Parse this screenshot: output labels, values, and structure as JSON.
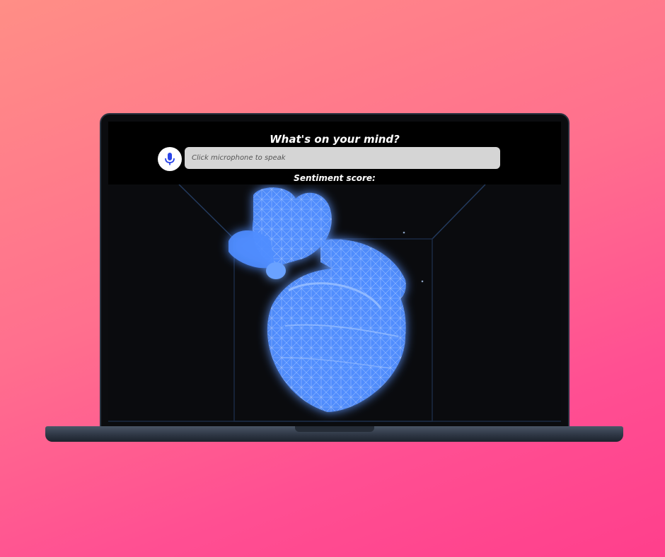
{
  "app": {
    "prompt_title": "What's on your mind?",
    "input_placeholder": "Click microphone to speak",
    "sentiment_label": "Sentiment score:"
  },
  "icons": {
    "mic": "microphone-icon",
    "heart": "wireframe-heart-model"
  },
  "colors": {
    "background_top": "#ff8e86",
    "background_bottom": "#ff3f8c",
    "heart_glow": "#4f8dff",
    "mic_icon": "#2a45e8"
  }
}
